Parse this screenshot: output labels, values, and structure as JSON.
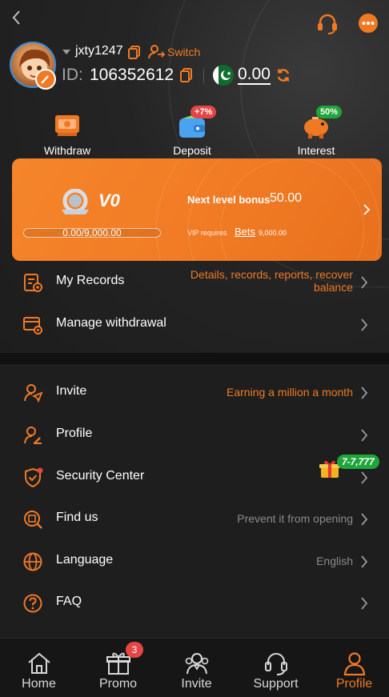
{
  "header": {
    "username": "jxty1247",
    "switch_label": "Switch",
    "id_label": "ID:",
    "id_value": "106352612",
    "balance": "0.00"
  },
  "quick_actions": [
    {
      "label": "Withdraw",
      "icon": "withdraw-icon"
    },
    {
      "label": "Deposit",
      "icon": "wallet-icon",
      "badge": "+7%"
    },
    {
      "label": "Interest",
      "icon": "piggy-bank-icon",
      "badge": "50%"
    }
  ],
  "vip": {
    "level": "V0",
    "progress_text": "0.00/9,000.00",
    "progress_fraction": 0,
    "next_level_label": "Next level bonus",
    "next_level_value": "50.00",
    "requires_label": "VIP requires",
    "requires_bets_label": "Bets",
    "requires_value": "9,000.00"
  },
  "menu_top": [
    {
      "label": "My Records",
      "hint": "Details, records, reports, recover balance"
    },
    {
      "label": "Manage withdrawal",
      "hint": ""
    }
  ],
  "menu_bottom": [
    {
      "label": "Invite",
      "hint": "Earning a million a month"
    },
    {
      "label": "Profile",
      "hint": ""
    },
    {
      "label": "Security Center",
      "hint": ""
    },
    {
      "label": "Find us",
      "hint": "Prevent it from opening"
    },
    {
      "label": "Language",
      "hint": "English"
    },
    {
      "label": "FAQ",
      "hint": ""
    }
  ],
  "gift_badge": "7-7,777",
  "bottom_nav": [
    {
      "label": "Home",
      "icon": "home-icon"
    },
    {
      "label": "Promo",
      "icon": "gift-box-icon",
      "badge": "3"
    },
    {
      "label": "Invite",
      "icon": "invite-people-icon"
    },
    {
      "label": "Support",
      "icon": "headset-icon"
    },
    {
      "label": "Profile",
      "icon": "user-icon",
      "active": true
    }
  ],
  "colors": {
    "accent": "#f07a24",
    "background": "#1e1e1e",
    "badge_red": "#e54545",
    "badge_green": "#1fa63a"
  }
}
